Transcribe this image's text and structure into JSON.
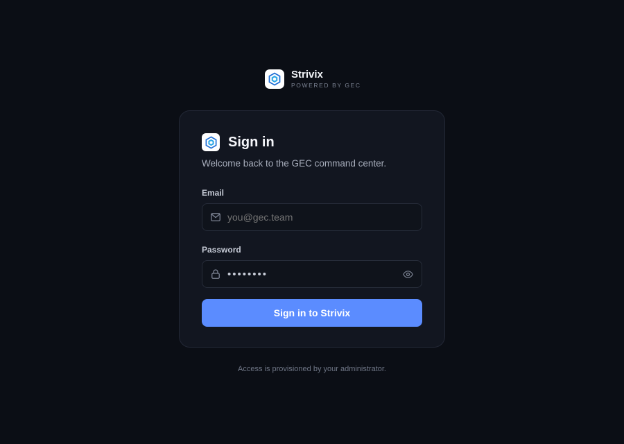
{
  "brand": {
    "name": "Strivix",
    "tagline": "POWERED BY GEC",
    "logo_icon": "hexagon-logo-icon"
  },
  "card": {
    "title": "Sign in",
    "subtitle": "Welcome back to the GEC command center."
  },
  "form": {
    "email": {
      "label": "Email",
      "placeholder": "you@gec.team",
      "value": "",
      "icon": "mail-icon"
    },
    "password": {
      "label": "Password",
      "value": "••••••••",
      "icon": "lock-icon",
      "toggle_icon": "eye-icon"
    },
    "submit_label": "Sign in to Strivix"
  },
  "footer": {
    "note": "Access is provisioned by your administrator."
  },
  "colors": {
    "background": "#0b0e15",
    "card": "#121620",
    "accent": "#5b8cff"
  }
}
